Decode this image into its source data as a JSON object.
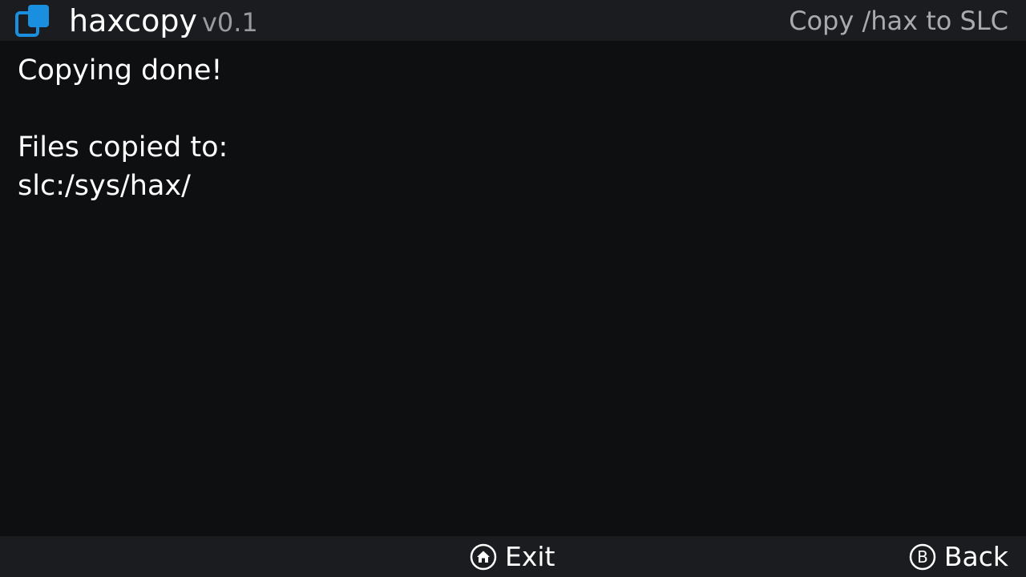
{
  "header": {
    "app_name": "haxcopy",
    "version": "v0.1",
    "title": "Copy /hax to SLC",
    "logo_icon": "copy-windows-icon"
  },
  "console": {
    "lines": [
      "Copying done!",
      "",
      "Files copied to:",
      "slc:/sys/hax/"
    ]
  },
  "footer": {
    "exit": {
      "icon": "home-button-icon",
      "label": "Exit"
    },
    "back": {
      "icon": "b-button-icon",
      "label": "Back"
    }
  },
  "colors": {
    "background": "#0e0f11",
    "bar": "#1b1c20",
    "accent": "#1a8fe0",
    "muted_text": "#a9aaae"
  }
}
